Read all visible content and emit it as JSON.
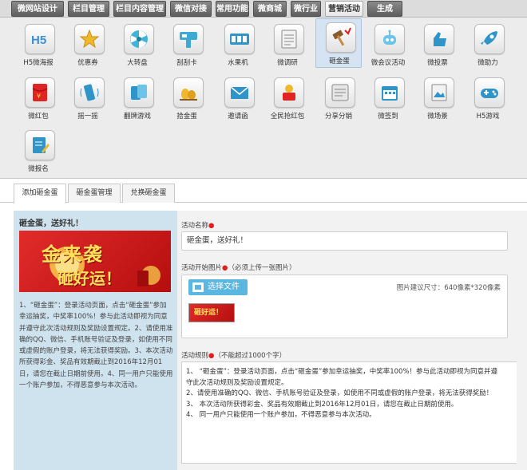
{
  "topnav": {
    "tabs": [
      {
        "label": "微网站设计",
        "active": false
      },
      {
        "label": "栏目管理",
        "active": false
      },
      {
        "label": "栏目内容管理",
        "active": false
      },
      {
        "label": "微信对接",
        "active": false
      },
      {
        "label": "常用功能",
        "active": false
      },
      {
        "label": "微商城",
        "active": false
      },
      {
        "label": "微行业",
        "active": false
      },
      {
        "label": "营销活动",
        "active": true
      },
      {
        "label": "生成APP",
        "active": false
      }
    ]
  },
  "grid": {
    "items": [
      {
        "label": "H5微海报",
        "icon": "h5-icon"
      },
      {
        "label": "优惠券",
        "icon": "star-icon"
      },
      {
        "label": "大转盘",
        "icon": "wheel-icon"
      },
      {
        "label": "刮刮卡",
        "icon": "scratch-card-icon"
      },
      {
        "label": "水果机",
        "icon": "slot-machine-icon"
      },
      {
        "label": "微调研",
        "icon": "survey-icon"
      },
      {
        "label": "砸金蛋",
        "icon": "hammer-icon",
        "selected": true
      },
      {
        "label": "微会议活动",
        "icon": "robot-icon"
      },
      {
        "label": "微投票",
        "icon": "vote-icon"
      },
      {
        "label": "微助力",
        "icon": "rocket-icon"
      },
      {
        "label": "微红包",
        "icon": "red-envelope-icon"
      },
      {
        "label": "摇一摇",
        "icon": "shake-icon"
      },
      {
        "label": "翻牌游戏",
        "icon": "cards-icon"
      },
      {
        "label": "拾金蛋",
        "icon": "gold-eggs-icon"
      },
      {
        "label": "邀请函",
        "icon": "invitation-icon"
      },
      {
        "label": "全民抢红包",
        "icon": "grab-envelope-icon"
      },
      {
        "label": "分享分销",
        "icon": "share-icon"
      },
      {
        "label": "微签到",
        "icon": "calendar-icon"
      },
      {
        "label": "微场景",
        "icon": "scene-icon"
      },
      {
        "label": "H5游戏",
        "icon": "gamepad-icon"
      },
      {
        "label": "微报名",
        "icon": "signup-icon"
      }
    ]
  },
  "subtabs": {
    "items": [
      {
        "label": "添加砸金蛋",
        "active": true
      },
      {
        "label": "砸金蛋管理",
        "active": false
      },
      {
        "label": "兑换砸金蛋",
        "active": false
      }
    ]
  },
  "preview": {
    "title": "砸金蛋，送好礼！",
    "banner_big": "金来袭",
    "banner_sub": "砸好运！",
    "description": "1、“砸金蛋”：登录活动页面，点击“砸金蛋”参加幸运抽奖，中奖率100%！参与此活动即视为同意并遵守此次活动规则及奖励设置规定。2、请使用准确的QQ、微信、手机账号验证及登录，如使用不同或虚假的账户登录，将无法获得奖励。3、本次活动所获得彩金、奖品有效期截止到2016年12月01日，请您在截止日期前使用。4、同一用户只能使用一个账户参加，不得恶意参与本次活动。"
  },
  "form": {
    "name_label": "活动名称",
    "name_value": "砸金蛋，送好礼！",
    "image_label": "活动开始图片",
    "image_hint": "（必须上传一张图片）",
    "upload_label": "选择文件",
    "size_hint": "图片建议尺寸：640像素*320像素",
    "rules_label": "活动规则",
    "rules_hint": "（不能超过1000个字）",
    "rules_lines": [
      "1、  “砸金蛋”：登录活动页面，点击“砸金蛋”参加幸运抽奖，中奖率100%！参与此活动即视为同意并遵",
      "守此次活动规则及奖励设置规定。",
      "2、请使用准确的QQ、微信、手机账号验证及登录，如使用不同或虚假的账户登录，将无法获得奖励！",
      "3、  本次活动所获得彩金、奖品有效期截止到2016年12月01日，请您在截止日期前使用。",
      "4、  同一用户只能使用一个账户参加，不得恶意参与本次活动。"
    ]
  },
  "colors": {
    "accent_blue": "#5bb7df",
    "required_red": "#e01e1e",
    "preview_bg": "#cfe3ef",
    "banner_red": "#d32020"
  }
}
